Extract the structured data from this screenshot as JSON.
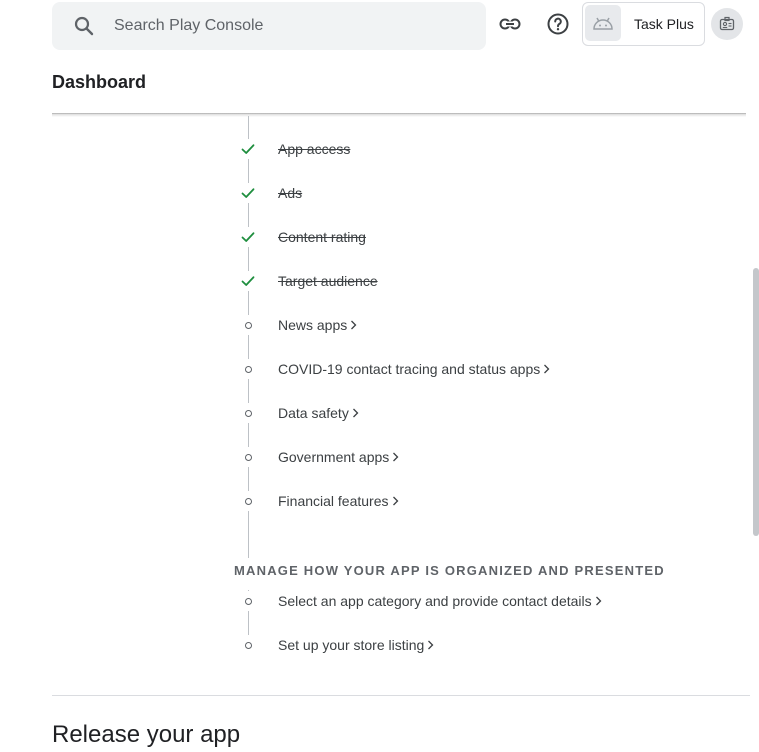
{
  "search": {
    "placeholder": "Search Play Console",
    "value": ""
  },
  "topbar": {
    "link_icon": "link-icon",
    "help_icon": "help-icon",
    "account_icon": "account-badge-icon"
  },
  "app": {
    "name": "Task Plus",
    "icon": "android-icon"
  },
  "page": {
    "title": "Dashboard"
  },
  "tasks_top": [
    {
      "label": "App access",
      "status": "done"
    },
    {
      "label": "Ads",
      "status": "done"
    },
    {
      "label": "Content rating",
      "status": "done"
    },
    {
      "label": "Target audience",
      "status": "done"
    },
    {
      "label": "News apps",
      "status": "todo"
    },
    {
      "label": "COVID-19 contact tracing and status apps",
      "status": "todo"
    },
    {
      "label": "Data safety",
      "status": "todo"
    },
    {
      "label": "Government apps",
      "status": "todo"
    },
    {
      "label": "Financial features",
      "status": "todo"
    }
  ],
  "manage_section": {
    "heading": "MANAGE HOW YOUR APP IS ORGANIZED AND PRESENTED",
    "tasks": [
      {
        "label": "Select an app category and provide contact details",
        "status": "todo"
      },
      {
        "label": "Set up your store listing",
        "status": "todo"
      }
    ]
  },
  "release": {
    "title": "Release your app"
  },
  "colors": {
    "check": "#1e8e3e",
    "accent": "#1a73e8",
    "ring": "#5f6368"
  }
}
